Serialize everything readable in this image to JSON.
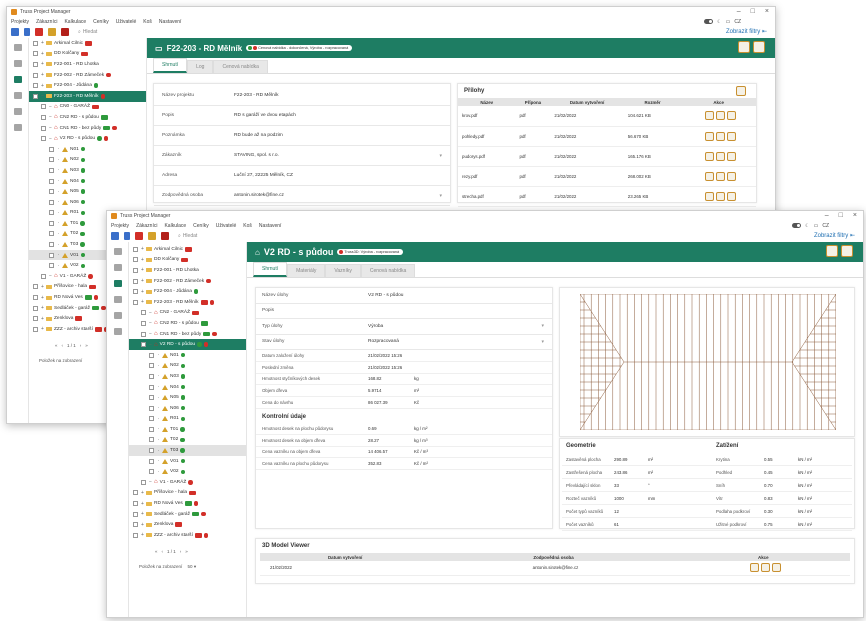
{
  "colors": {
    "accent": "#1e7d63",
    "danger": "#d22f28",
    "ok": "#2e9a3c",
    "folder": "#e8b94a",
    "warning": "#d4a12a"
  },
  "app": {
    "title": "Truss Project Manager",
    "theme_label": "CZ",
    "win_minimize": "–",
    "win_maximize": "□",
    "win_close": "×"
  },
  "menu": [
    "Projekty",
    "Zákazníci",
    "Kalkulace",
    "Ceníky",
    "Uživatelé",
    "Koš",
    "Nastavení"
  ],
  "search_placeholder": "Hledat",
  "filters_label": "Zobrazit filtry",
  "tree1": [
    {
      "label": "Arkimal Cilnic",
      "kind": "folder",
      "tag": "r"
    },
    {
      "label": "DD Kolčany",
      "kind": "folder",
      "tag": "r"
    },
    {
      "label": "F22-001 - RD Lhotka",
      "kind": "folder"
    },
    {
      "label": "F22-002 - RD Zámeček",
      "kind": "folder",
      "dot": "r"
    },
    {
      "label": "F22-004 - Jůdána",
      "kind": "folder",
      "dot": "g"
    },
    {
      "label": "F22-203 - RD Mělník",
      "kind": "folder",
      "sel": true,
      "dot": "r"
    },
    {
      "label": "CN0 - GARÁŽ",
      "kind": "house",
      "tag": "r",
      "indent": 1
    },
    {
      "label": "CN2 RD - s půdou",
      "kind": "house",
      "tag": "g",
      "indent": 1
    },
    {
      "label": "CN1 RD - bez půdy",
      "kind": "house",
      "tag": "g",
      "dot": "r",
      "indent": 1
    },
    {
      "label": "V2 RD - s půdou",
      "kind": "house",
      "dot": "g",
      "dot2": "r",
      "indent": 1
    },
    {
      "label": "N01",
      "kind": "tri",
      "dot": "g",
      "indent": 2
    },
    {
      "label": "N02",
      "kind": "tri",
      "dot": "g",
      "indent": 2
    },
    {
      "label": "N03",
      "kind": "tri",
      "dot": "g",
      "indent": 2
    },
    {
      "label": "N04",
      "kind": "tri",
      "dot": "g",
      "indent": 2
    },
    {
      "label": "N05",
      "kind": "tri",
      "dot": "g",
      "indent": 2
    },
    {
      "label": "N06",
      "kind": "tri",
      "dot": "g",
      "indent": 2
    },
    {
      "label": "R01",
      "kind": "tri",
      "dot": "g",
      "indent": 2
    },
    {
      "label": "T01",
      "kind": "tri",
      "dot": "g",
      "indent": 2
    },
    {
      "label": "T02",
      "kind": "tri",
      "dot": "g",
      "indent": 2
    },
    {
      "label": "T03",
      "kind": "tri",
      "dot": "g",
      "indent": 2
    },
    {
      "label": "V01",
      "kind": "tri",
      "dot": "g",
      "indent": 2,
      "grey": true
    },
    {
      "label": "V02",
      "kind": "tri",
      "dot": "g",
      "indent": 2
    },
    {
      "label": "V1 - GARÁŽ",
      "kind": "house",
      "dot": "r",
      "indent": 1
    },
    {
      "label": "Příšovice - hala",
      "kind": "folder",
      "tag": "r"
    },
    {
      "label": "RD Nová Ves",
      "kind": "folder",
      "tag": "g",
      "dot": "r"
    },
    {
      "label": "Sedláček - garáž",
      "kind": "folder",
      "tag": "g",
      "dot": "r"
    },
    {
      "label": "Zenklova",
      "kind": "folder",
      "tag": "r"
    },
    {
      "label": "ZZZ - archiv starší",
      "kind": "folder",
      "tag": "r",
      "dot": "r"
    }
  ],
  "tree2": [
    {
      "label": "Arkimal Cilnic",
      "kind": "folder",
      "tag": "r"
    },
    {
      "label": "DD Kolčany",
      "kind": "folder",
      "tag": "r"
    },
    {
      "label": "F22-001 - RD Lhotka",
      "kind": "folder"
    },
    {
      "label": "F22-002 - RD Zámeček",
      "kind": "folder",
      "dot": "r"
    },
    {
      "label": "F22-004 - Jůdána",
      "kind": "folder",
      "dot": "g"
    },
    {
      "label": "F22-203 - RD Mělník",
      "kind": "folder",
      "tag": "r",
      "dot": "r"
    },
    {
      "label": "CN2 - GARÁŽ",
      "kind": "house",
      "tag": "r",
      "indent": 1
    },
    {
      "label": "CN2 RD - s půdou",
      "kind": "house",
      "tag": "g",
      "indent": 1
    },
    {
      "label": "CN1 RD - bez půdy",
      "kind": "house",
      "tag": "g",
      "dot": "r",
      "indent": 1
    },
    {
      "label": "V2 RD - s půdou",
      "kind": "house",
      "sel": true,
      "dot": "g",
      "dot2": "r",
      "indent": 1
    },
    {
      "label": "N01",
      "kind": "tri",
      "dot": "g",
      "indent": 2
    },
    {
      "label": "N02",
      "kind": "tri",
      "dot": "g",
      "indent": 2
    },
    {
      "label": "N03",
      "kind": "tri",
      "dot": "g",
      "indent": 2
    },
    {
      "label": "N04",
      "kind": "tri",
      "dot": "g",
      "indent": 2
    },
    {
      "label": "N05",
      "kind": "tri",
      "dot": "g",
      "indent": 2
    },
    {
      "label": "N06",
      "kind": "tri",
      "dot": "g",
      "indent": 2
    },
    {
      "label": "R01",
      "kind": "tri",
      "dot": "g",
      "indent": 2
    },
    {
      "label": "T01",
      "kind": "tri",
      "dot": "g",
      "indent": 2
    },
    {
      "label": "T02",
      "kind": "tri",
      "dot": "g",
      "indent": 2
    },
    {
      "label": "T03",
      "kind": "tri",
      "dot": "g",
      "indent": 2,
      "grey": true
    },
    {
      "label": "V01",
      "kind": "tri",
      "dot": "g",
      "indent": 2
    },
    {
      "label": "V02",
      "kind": "tri",
      "dot": "g",
      "indent": 2
    },
    {
      "label": "V1 - GARÁŽ",
      "kind": "house",
      "dot": "r",
      "indent": 1
    },
    {
      "label": "Příšovice - hala",
      "kind": "folder",
      "tag": "r"
    },
    {
      "label": "RD Nová Ves",
      "kind": "folder",
      "tag": "g",
      "dot": "r"
    },
    {
      "label": "Sedláček - garáž",
      "kind": "folder",
      "tag": "g",
      "dot": "r"
    },
    {
      "label": "Zenklova",
      "kind": "folder",
      "tag": "r"
    },
    {
      "label": "ZZZ - archiv starší",
      "kind": "folder",
      "tag": "r",
      "dot": "r"
    }
  ],
  "pager": {
    "first": "«",
    "prev": "‹",
    "page": "1 / 1",
    "next": "›",
    "last": "»",
    "per_page_label": "Položek na zobrazení",
    "per_page_value": "50"
  },
  "w1": {
    "title": "F22-203 - RD Mělník",
    "badge": "Cenová nabídka - dokončená, Výroba - rozpracovaná",
    "tabs": [
      "Shrnutí",
      "Log",
      "Cenová nabídka"
    ],
    "fields": [
      {
        "label": "Název projektu",
        "value": "F22-203 - RD Mělník"
      },
      {
        "label": "Popis",
        "value": "RD s garáží ve dvou etapách"
      },
      {
        "label": "Poznámka",
        "value": "RD bude až na podzim"
      },
      {
        "label": "Zákazník",
        "value": "STAVING, spol. s r.o."
      },
      {
        "label": "Adresa",
        "value": "Luční 27, 22225 Mělník, CZ"
      },
      {
        "label": "Zodpovědná osoba",
        "value": "antonin.sirotek@fine.cz"
      }
    ],
    "attachments_title": "Přílohy",
    "att_headers": [
      "Název",
      "Přípona",
      "Datum vytvoření",
      "Rozměr",
      "Akce"
    ],
    "attachments": [
      {
        "name": "krov.pdf",
        "ext": "pdf",
        "date": "21/02/2022",
        "size": "104.621 KB"
      },
      {
        "name": "pohledy.pdf",
        "ext": "pdf",
        "date": "21/02/2022",
        "size": "56.670 KB"
      },
      {
        "name": "pudorys.pdf",
        "ext": "pdf",
        "date": "21/02/2022",
        "size": "165.176 KB"
      },
      {
        "name": "rezy.pdf",
        "ext": "pdf",
        "date": "21/02/2022",
        "size": "268.002 KB"
      },
      {
        "name": "strecha.pdf",
        "ext": "pdf",
        "date": "21/02/2022",
        "size": "23.265 KB"
      }
    ]
  },
  "w2": {
    "title": "V2 RD - s půdou",
    "badge": "Truss3D: Výroba - rozpracovaná",
    "tabs": [
      "Shrnutí",
      "Materiály",
      "Vazníky",
      "Cenová nabídka"
    ],
    "fields": [
      {
        "label": "Název úlohy",
        "value": "V2 RD - s půdou",
        "unit": ""
      },
      {
        "label": "Popis",
        "value": "",
        "unit": ""
      },
      {
        "label": "Typ úlohy",
        "value": "Výroba",
        "unit": "",
        "select": true
      },
      {
        "label": "Stav úlohy",
        "value": "Rozpracovaná",
        "unit": "",
        "select": true
      },
      {
        "label": "Datum založení úlohy",
        "value": "21/02/2022 15:26",
        "unit": ""
      },
      {
        "label": "Poslední změna",
        "value": "21/02/2022 15:26",
        "unit": ""
      },
      {
        "label": "Hmotnost styčníkových desek",
        "value": "168.82",
        "unit": "kg"
      },
      {
        "label": "Objem dřeva",
        "value": "5.9714",
        "unit": "m³"
      },
      {
        "label": "Cena do návrhu",
        "value": "86 027.39",
        "unit": "Kč"
      }
    ],
    "control_title": "Kontrolní údaje",
    "control": [
      {
        "label": "Hmotnost desek na plochu půdorysu",
        "value": "0.69",
        "unit": "kg / m²"
      },
      {
        "label": "Hmotnost desek na objem dřeva",
        "value": "28.27",
        "unit": "kg / m³"
      },
      {
        "label": "Cena vazníku na objem dřeva",
        "value": "14 406.57",
        "unit": "Kč / m³"
      },
      {
        "label": "Cena vazníku na plochu půdorysu",
        "value": "352.83",
        "unit": "Kč / m²"
      }
    ],
    "geometry_title": "Geometrie",
    "geometry": [
      {
        "label": "Zastavěná plocha",
        "value": "290.89",
        "unit": "m²"
      },
      {
        "label": "Zastřešená plocha",
        "value": "243.86",
        "unit": "m²"
      },
      {
        "label": "Převládající sklon",
        "value": "33",
        "unit": "°"
      },
      {
        "label": "Rozteč vazníků",
        "value": "1000",
        "unit": "mm"
      },
      {
        "label": "Počet typů vazníků",
        "value": "12",
        "unit": ""
      },
      {
        "label": "Počet vazníků",
        "value": "61",
        "unit": ""
      }
    ],
    "loads_title": "Zatížení",
    "loads": [
      {
        "label": "Krytina",
        "value": "0.55",
        "unit": "kN / m²"
      },
      {
        "label": "Podhled",
        "value": "0.45",
        "unit": "kN / m²"
      },
      {
        "label": "Sníh",
        "value": "0.70",
        "unit": "kN / m²"
      },
      {
        "label": "Vítr",
        "value": "0.83",
        "unit": "kN / m²"
      },
      {
        "label": "Podlaha podkroví",
        "value": "0.30",
        "unit": "kN / m²"
      },
      {
        "label": "Užitné podkroví",
        "value": "0.75",
        "unit": "kN / m²"
      }
    ],
    "viewer_title": "3D Model Viewer",
    "viewer_headers": [
      "Datum vytvoření",
      "Zodpovědná osoba",
      "Akce"
    ],
    "viewer_row": {
      "date": "21/02/2022",
      "person": "antonin.sirotek@fine.cz"
    }
  }
}
